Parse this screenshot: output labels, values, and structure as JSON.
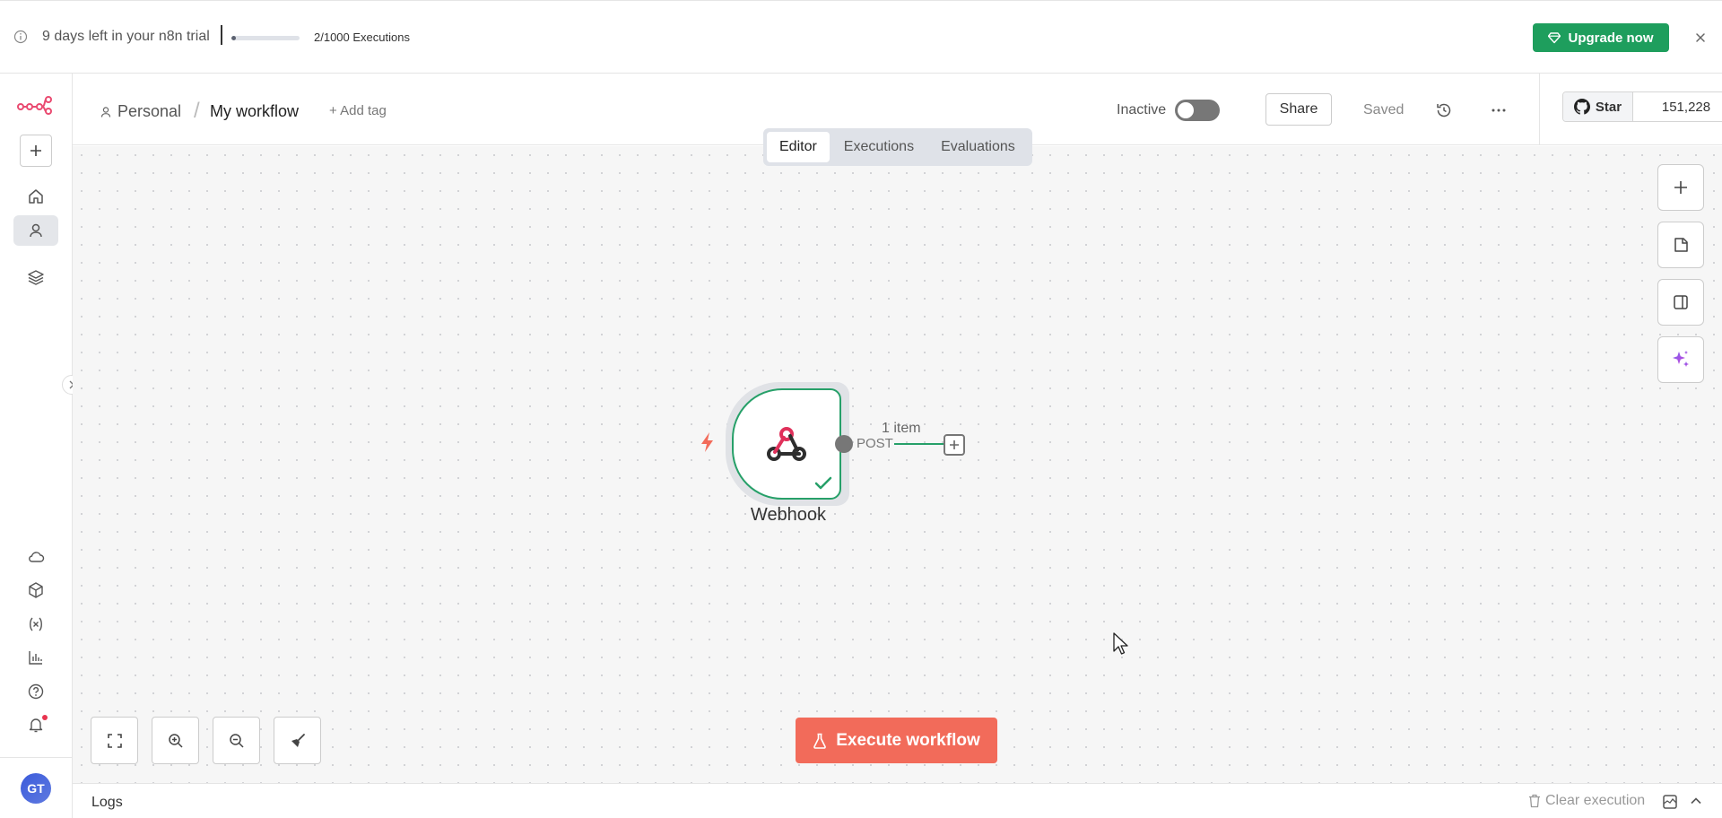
{
  "banner": {
    "trial_text": "9 days left in your n8n trial",
    "executions_used": 2,
    "executions_limit": 1000,
    "executions_text": "2/1000 Executions",
    "upgrade_label": "Upgrade now",
    "upgrade_color": "#1e9e5d"
  },
  "header": {
    "project": "Personal",
    "separator": "/",
    "workflow_name": "My workflow",
    "add_tag": "+ Add tag",
    "status_label": "Inactive",
    "share_label": "Share",
    "saved_label": "Saved",
    "github_star_label": "Star",
    "github_star_count": "151,228"
  },
  "tabs": [
    {
      "label": "Editor",
      "active": true
    },
    {
      "label": "Executions",
      "active": false
    },
    {
      "label": "Evaluations",
      "active": false
    }
  ],
  "canvas": {
    "node": {
      "label": "Webhook",
      "output_label": "POST",
      "items_label": "1 item",
      "status": "success"
    },
    "execute_label": "Execute workflow",
    "execute_color": "#f26b5a"
  },
  "sidebar": {
    "user_initials": "GT",
    "items": [
      "home-icon",
      "person-icon",
      "layers-icon",
      "cloud-icon",
      "package-icon",
      "variables-icon",
      "chart-icon",
      "help-icon",
      "bell-icon"
    ]
  },
  "logs": {
    "title": "Logs",
    "clear_label": "Clear execution"
  }
}
